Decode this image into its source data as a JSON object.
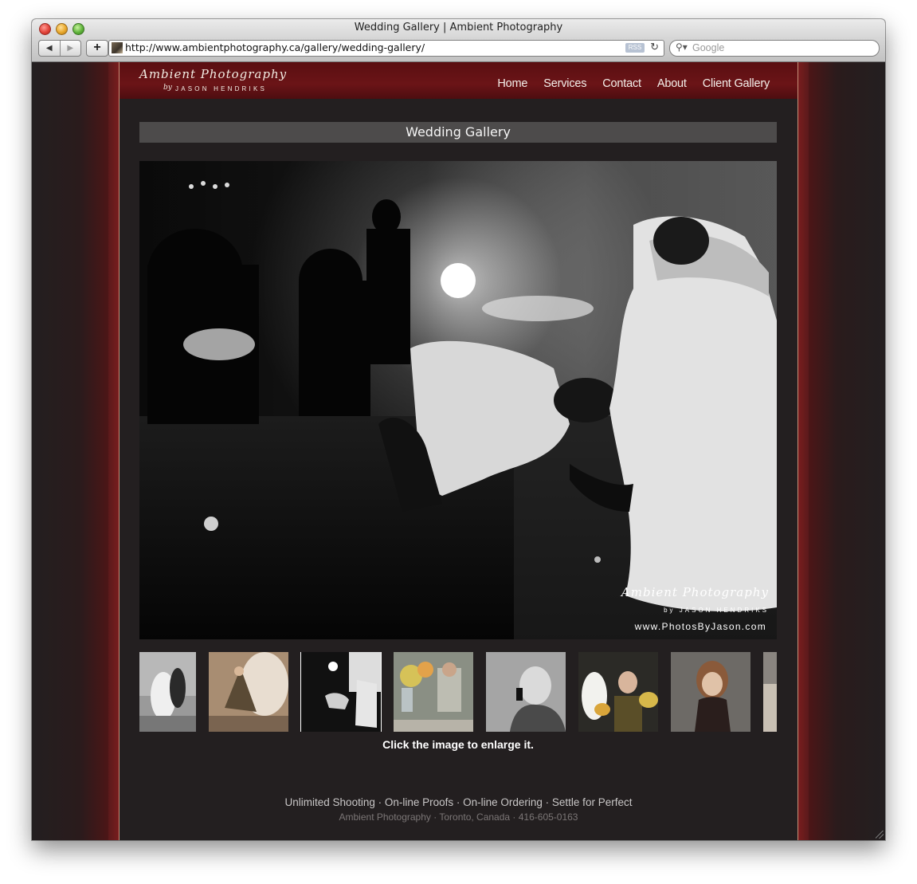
{
  "window": {
    "title": "Wedding Gallery | Ambient Photography"
  },
  "toolbar": {
    "back_icon": "back-arrow-icon",
    "forward_icon": "forward-arrow-icon",
    "add_bookmark": "+",
    "url": "http://www.ambientphotography.ca/gallery/wedding-gallery/",
    "rss_label": "RSS",
    "reload_icon": "reload-icon",
    "search_placeholder": "Google"
  },
  "site": {
    "logo": {
      "title": "Ambient Photography",
      "by": "by",
      "name": "JASON HENDRIKS"
    },
    "nav": [
      "Home",
      "Services",
      "Contact",
      "About",
      "Client Gallery"
    ],
    "gallery_title": "Wedding Gallery",
    "photo_watermark": {
      "line1": "Ambient Photography",
      "line2": "by JASON HENDRIKS",
      "line3": "www.PhotosByJason.com"
    },
    "thumbnails": [
      {
        "name": "couple-kiss",
        "active": false
      },
      {
        "name": "bride-fan",
        "active": false
      },
      {
        "name": "garter-toss",
        "active": true
      },
      {
        "name": "flowers-table",
        "active": false
      },
      {
        "name": "man-microphone",
        "active": false
      },
      {
        "name": "bridal-party",
        "active": false
      },
      {
        "name": "flower-girl",
        "active": false
      },
      {
        "name": "partial-next",
        "active": false
      }
    ],
    "hint": "Click the image to enlarge it.",
    "footer_links": "Unlimited Shooting · On-line Proofs · On-line Ordering · Settle for Perfect",
    "footer_info": "Ambient Photography · Toronto, Canada · 416-605-0163"
  }
}
